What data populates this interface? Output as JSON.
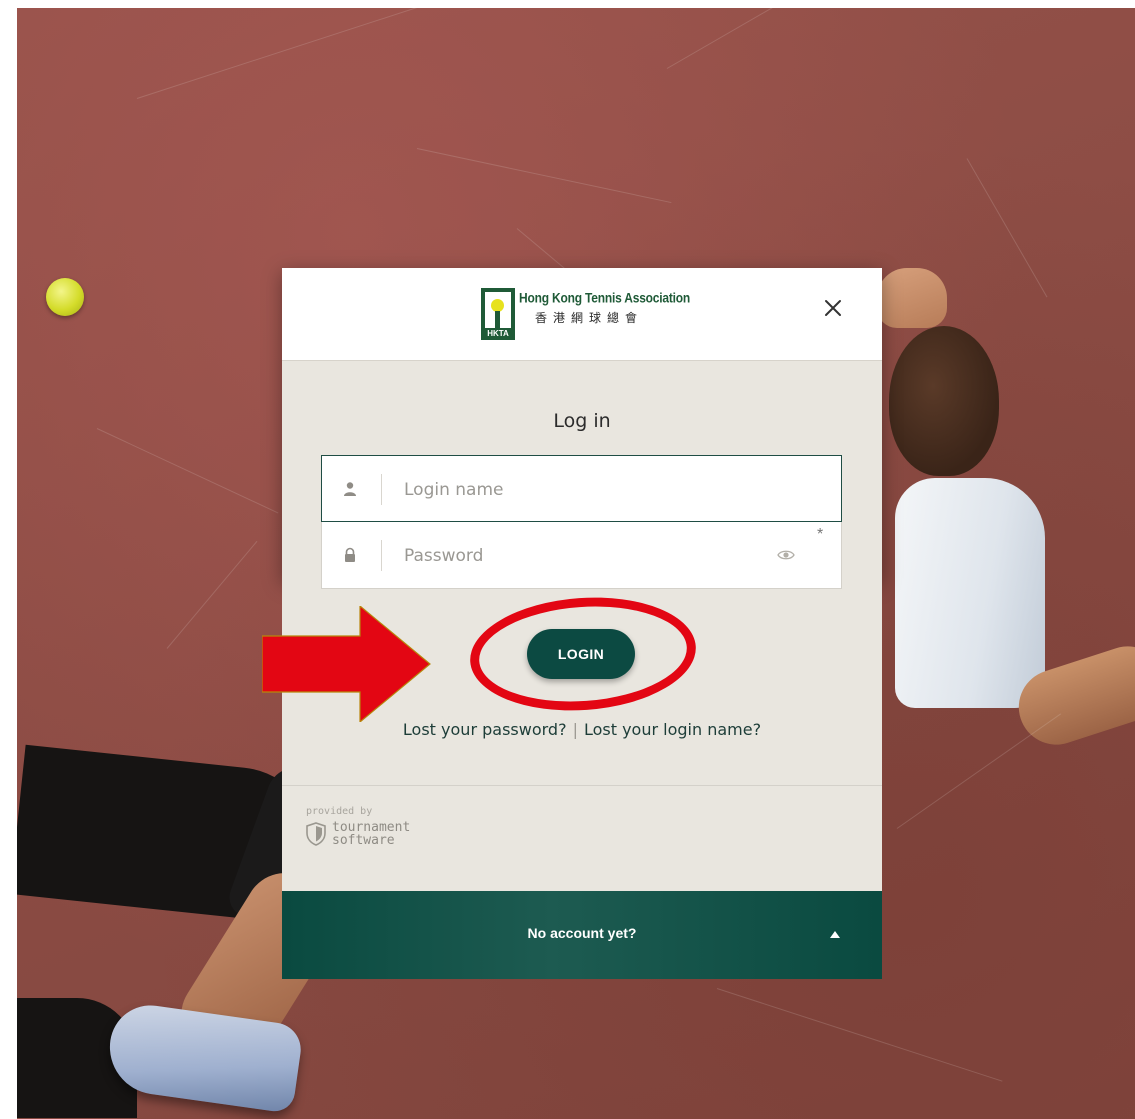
{
  "brand": {
    "name_en": "Hong Kong Tennis Association",
    "name_zh": "香港網球總會",
    "badge": "HKTA"
  },
  "dialog": {
    "title": "Log in",
    "login_placeholder": "Login name",
    "password_placeholder": "Password",
    "required_mark": "*",
    "login_button": "LOGIN",
    "lost_password": "Lost your password?",
    "separator": "|",
    "lost_login_name": "Lost your login name?",
    "provided_by": "provided by",
    "provider_line1": "tournament",
    "provider_line2": "software",
    "no_account": "No account yet?"
  },
  "icons": {
    "close": "close-icon",
    "user": "user-icon",
    "lock": "lock-icon",
    "eye": "eye-icon",
    "caret": "caret-up-icon",
    "shield": "shield-icon"
  },
  "colors": {
    "primary": "#0c4a42",
    "panel": "#e9e6df",
    "annotation": "#e30613"
  }
}
